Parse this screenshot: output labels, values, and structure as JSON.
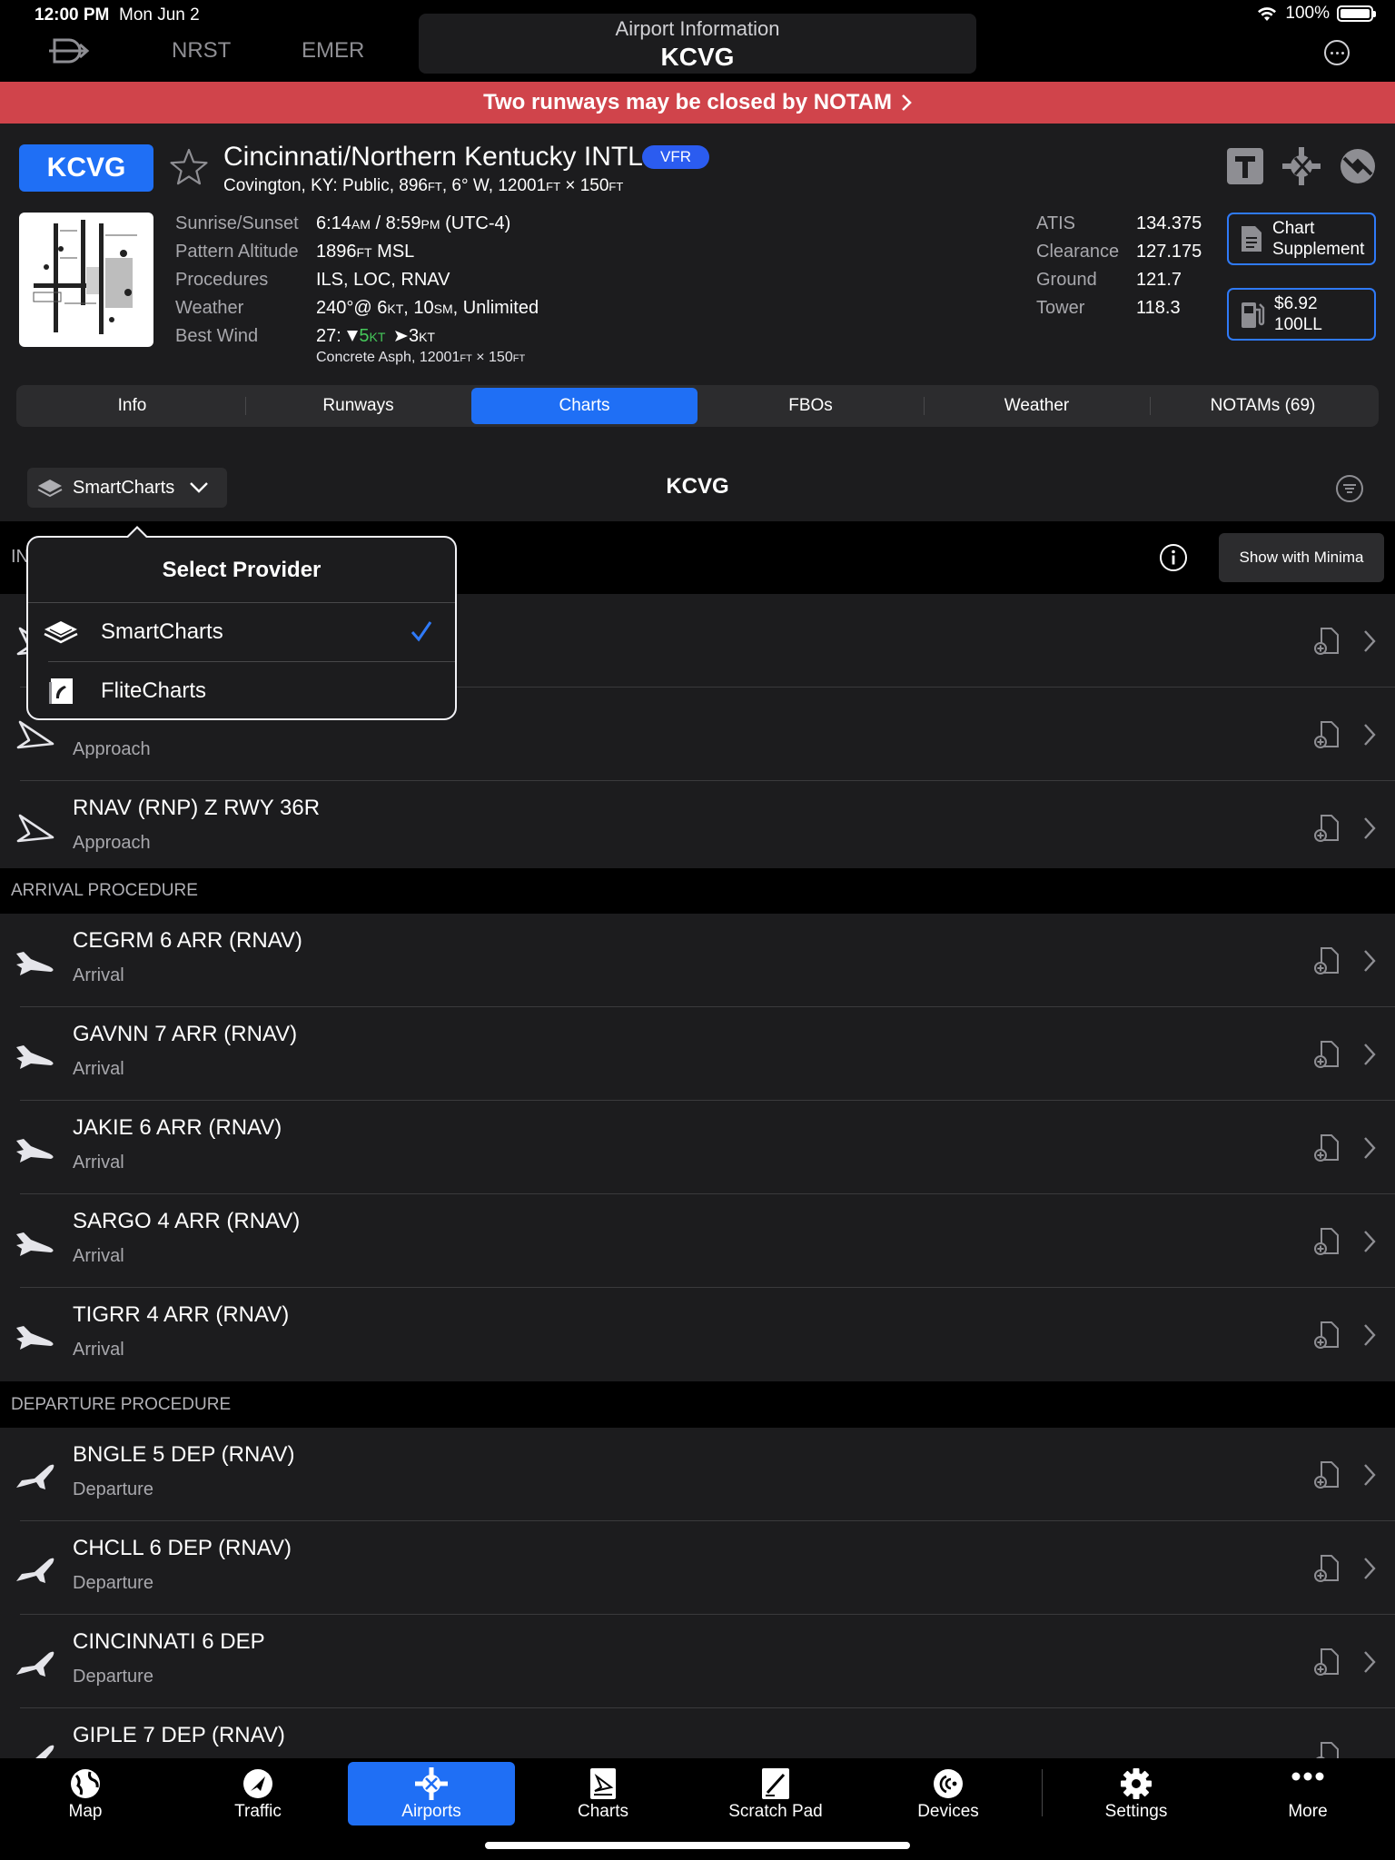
{
  "status": {
    "time": "12:00 PM",
    "date": "Mon Jun 2",
    "battery": "100%"
  },
  "nav": {
    "nrst": "NRST",
    "emer": "EMER"
  },
  "title": {
    "sub": "Airport Information",
    "main": "KCVG"
  },
  "notam_banner": "Two runways may be closed by NOTAM",
  "airport": {
    "ident": "KCVG",
    "name": "Cincinnati/Northern Kentucky INTL",
    "flight_rules": "VFR",
    "sub_a": "Covington, KY: Public, 896",
    "sub_ft1": "FT",
    "sub_b": ", 6° W, 12001",
    "sub_ft2": "FT",
    "sub_c": " × 150",
    "sub_ft3": "FT"
  },
  "info": {
    "labels": [
      "Sunrise/Sunset",
      "Pattern Altitude",
      "Procedures",
      "Weather",
      "Best Wind"
    ],
    "sunrise_a": "6:14",
    "sunrise_am": "AM",
    "sunrise_b": " / 8:59",
    "sunrise_pm": "PM",
    "sunrise_c": " (UTC-4)",
    "pattern_a": "1896",
    "pattern_ft": "FT",
    "pattern_b": " MSL",
    "procedures": "ILS, LOC, RNAV",
    "weather_a": "240°@ 6",
    "weather_kt": "KT",
    "weather_b": ", 10",
    "weather_sm": "SM",
    "weather_c": ", Unlimited",
    "wind_rwy": "27: ",
    "wind_head": "5",
    "wind_head_kt": "KT",
    "wind_cross": "3",
    "wind_cross_kt": "KT",
    "runway_a": "Concrete Asph, 12001",
    "runway_ft1": "FT",
    "runway_b": " × 150",
    "runway_ft2": "FT"
  },
  "frequencies": [
    {
      "label": "ATIS",
      "value": "134.375"
    },
    {
      "label": "Clearance",
      "value": "127.175"
    },
    {
      "label": "Ground",
      "value": "121.7"
    },
    {
      "label": "Tower",
      "value": "118.3"
    }
  ],
  "side_buttons": {
    "chart_line1": "Chart",
    "chart_line2": "Supplement",
    "fuel_line1": "$6.92",
    "fuel_line2": "100LL"
  },
  "tabs": [
    "Info",
    "Runways",
    "Charts",
    "FBOs",
    "Weather",
    "NOTAMs (69)"
  ],
  "toolbar": {
    "provider": "SmartCharts",
    "title": "KCVG",
    "show_minima": "Show with Minima",
    "strip_label": "IN"
  },
  "popover": {
    "title": "Select Provider",
    "items": [
      "SmartCharts",
      "FliteCharts"
    ],
    "selected": "SmartCharts"
  },
  "sections": {
    "arrival": "ARRIVAL PROCEDURE",
    "departure": "DEPARTURE PROCEDURE"
  },
  "approach_rows": [
    {
      "title": "",
      "sub": "Approach"
    },
    {
      "title": "RNAV (RNP) Z RWY 36R",
      "sub": "Approach"
    }
  ],
  "arrival_rows": [
    {
      "title": "CEGRM 6 ARR (RNAV)",
      "sub": "Arrival"
    },
    {
      "title": "GAVNN 7 ARR (RNAV)",
      "sub": "Arrival"
    },
    {
      "title": "JAKIE 6 ARR (RNAV)",
      "sub": "Arrival"
    },
    {
      "title": "SARGO 4 ARR (RNAV)",
      "sub": "Arrival"
    },
    {
      "title": "TIGRR 4 ARR (RNAV)",
      "sub": "Arrival"
    }
  ],
  "departure_rows": [
    {
      "title": "BNGLE 5 DEP (RNAV)",
      "sub": "Departure"
    },
    {
      "title": "CHCLL 6 DEP (RNAV)",
      "sub": "Departure"
    },
    {
      "title": "CINCINNATI 6 DEP",
      "sub": "Departure"
    },
    {
      "title": "GIPLE 7 DEP (RNAV)",
      "sub": ""
    }
  ],
  "tabbar": [
    "Map",
    "Traffic",
    "Airports",
    "Charts",
    "Scratch Pad",
    "Devices",
    "Settings",
    "More"
  ],
  "colors": {
    "accent": "#1f6ff5",
    "notam": "#d0444b",
    "wind_green": "#45c85a"
  }
}
